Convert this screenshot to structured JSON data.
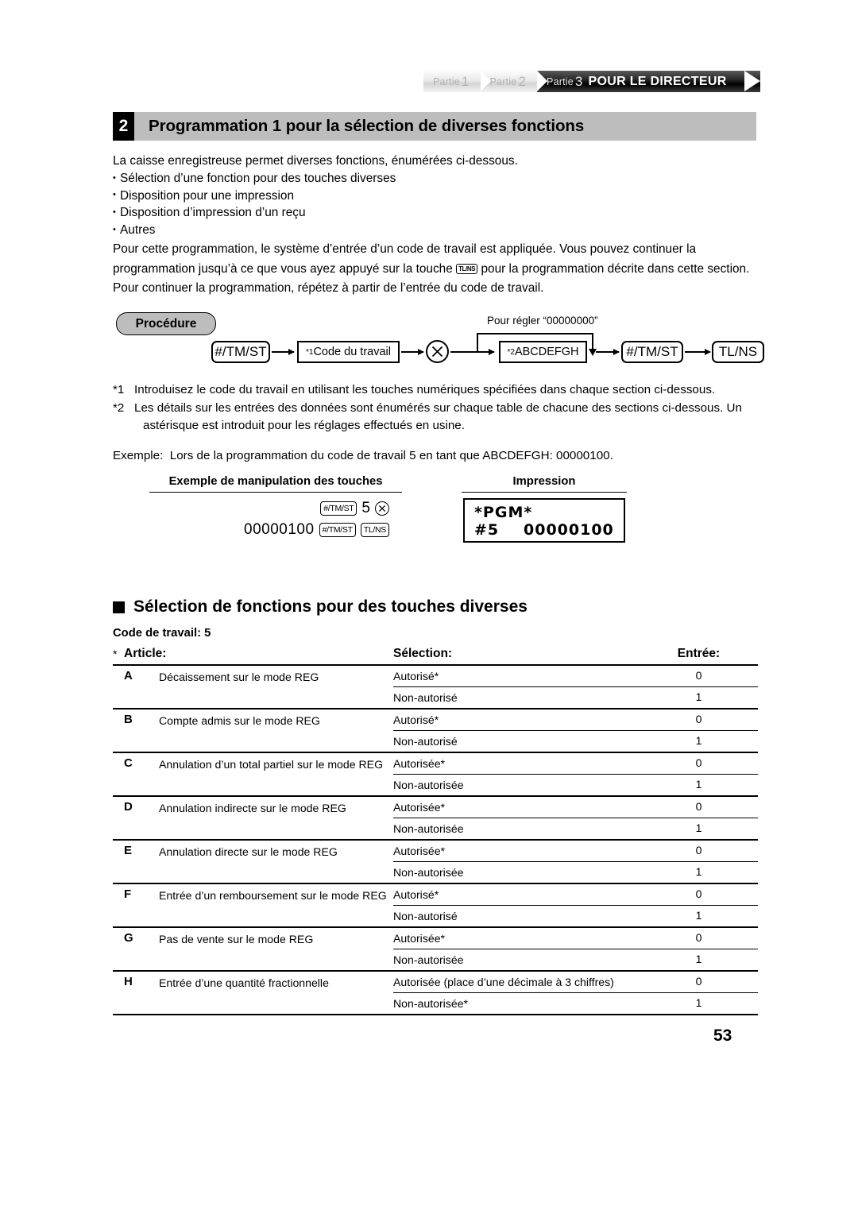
{
  "header": {
    "parts": [
      {
        "label": "Partie",
        "number": "1",
        "active": false
      },
      {
        "label": "Partie",
        "number": "2",
        "active": false
      },
      {
        "label": "Partie",
        "number": "3",
        "active": true,
        "title": "POUR LE DIRECTEUR"
      }
    ]
  },
  "section": {
    "number": "2",
    "title": "Programmation 1 pour la sélection de diverses fonctions"
  },
  "intro": {
    "lead": "La caisse enregistreuse permet diverses fonctions, énumérées ci-dessous.",
    "bullets": [
      "Sélection d’une fonction pour des touches diverses",
      "Disposition pour une impression",
      "Disposition d’impression d’un reçu",
      "Autres"
    ],
    "paragraph_part1": "Pour cette programmation, le système d’entrée d’un code de travail est appliquée. Vous pouvez continuer la programmation jusqu’à ce que vous ayez appuyé sur la touche ",
    "paragraph_key": "TL/NS",
    "paragraph_part2": " pour la programmation décrite dans cette section. Pour continuer la programmation, répétez à partir de l’entrée du code de travail."
  },
  "procedure": {
    "badge": "Procédure",
    "loop_label": "Pour régler “00000000”",
    "steps": [
      {
        "name": "key-tm-st-1",
        "text": "#/TM/ST",
        "shape": "round"
      },
      {
        "name": "code-du-travail",
        "text": "Code du travail",
        "sup": "*1",
        "shape": "square"
      },
      {
        "name": "multiply-key",
        "text": "⊗",
        "shape": "circle"
      },
      {
        "name": "abcdefgh",
        "text": "ABCDEFGH",
        "sup": "*2",
        "shape": "square"
      },
      {
        "name": "key-tm-st-2",
        "text": "#/TM/ST",
        "shape": "round"
      },
      {
        "name": "key-tl-ns",
        "text": "TL/NS",
        "shape": "round"
      }
    ]
  },
  "footnotes": {
    "fn1_marker": "*1",
    "fn1_text": "Introduisez le code du travail en utilisant les touches numériques spécifiées dans chaque section ci-dessous.",
    "fn2_marker": "*2",
    "fn2_text": "Les détails sur les entrées des données sont énumérés sur chaque table de chacune des sections ci-dessous. Un astérisque est introduit pour les réglages effectués en usine.",
    "example_marker": "Exemple:",
    "example_text": "Lors de la programmation du code de travail 5 en tant que ABCDEFGH: 00000100."
  },
  "example": {
    "keys_heading": "Exemple de manipulation des touches",
    "print_heading": "Impression",
    "row1": {
      "key1": "#/TM/ST",
      "number": "5",
      "multiply": "⊗"
    },
    "row2": {
      "amount": "00000100",
      "key1": "#/TM/ST",
      "key2": "TL/NS"
    },
    "receipt": {
      "line1": "*PGM*",
      "line2_label": "#5",
      "line2_value": "00000100"
    }
  },
  "subsection": {
    "title": "Sélection de fonctions pour des touches diverses",
    "job_code_label": "Code de travail:",
    "job_code_value": "5"
  },
  "table": {
    "star": "*",
    "headers": {
      "article": "Article:",
      "selection": "Sélection:",
      "entry": "Entrée:"
    },
    "rows": [
      {
        "letter": "A",
        "description": "Décaissement sur le mode REG",
        "options": [
          {
            "selection": "Autorisé*",
            "entry": "0"
          },
          {
            "selection": "Non-autorisé",
            "entry": "1"
          }
        ]
      },
      {
        "letter": "B",
        "description": "Compte admis sur le mode REG",
        "options": [
          {
            "selection": "Autorisé*",
            "entry": "0"
          },
          {
            "selection": "Non-autorisé",
            "entry": "1"
          }
        ]
      },
      {
        "letter": "C",
        "description": "Annulation d’un total partiel sur le mode REG",
        "options": [
          {
            "selection": "Autorisée*",
            "entry": "0"
          },
          {
            "selection": "Non-autorisée",
            "entry": "1"
          }
        ]
      },
      {
        "letter": "D",
        "description": "Annulation indirecte sur le mode REG",
        "options": [
          {
            "selection": "Autorisée*",
            "entry": "0"
          },
          {
            "selection": "Non-autorisée",
            "entry": "1"
          }
        ]
      },
      {
        "letter": "E",
        "description": "Annulation directe sur le mode REG",
        "options": [
          {
            "selection": "Autorisée*",
            "entry": "0"
          },
          {
            "selection": "Non-autorisée",
            "entry": "1"
          }
        ]
      },
      {
        "letter": "F",
        "description": "Entrée d’un remboursement sur le mode REG",
        "options": [
          {
            "selection": "Autorisé*",
            "entry": "0"
          },
          {
            "selection": "Non-autorisé",
            "entry": "1"
          }
        ]
      },
      {
        "letter": "G",
        "description": "Pas de vente sur le mode REG",
        "options": [
          {
            "selection": "Autorisée*",
            "entry": "0"
          },
          {
            "selection": "Non-autorisée",
            "entry": "1"
          }
        ]
      },
      {
        "letter": "H",
        "description": "Entrée d’une quantité fractionnelle",
        "options": [
          {
            "selection": "Autorisée (place d’une décimale à 3 chiffres)",
            "entry": "0"
          },
          {
            "selection": "Non-autorisée*",
            "entry": "1"
          }
        ]
      }
    ]
  },
  "page_number": "53"
}
